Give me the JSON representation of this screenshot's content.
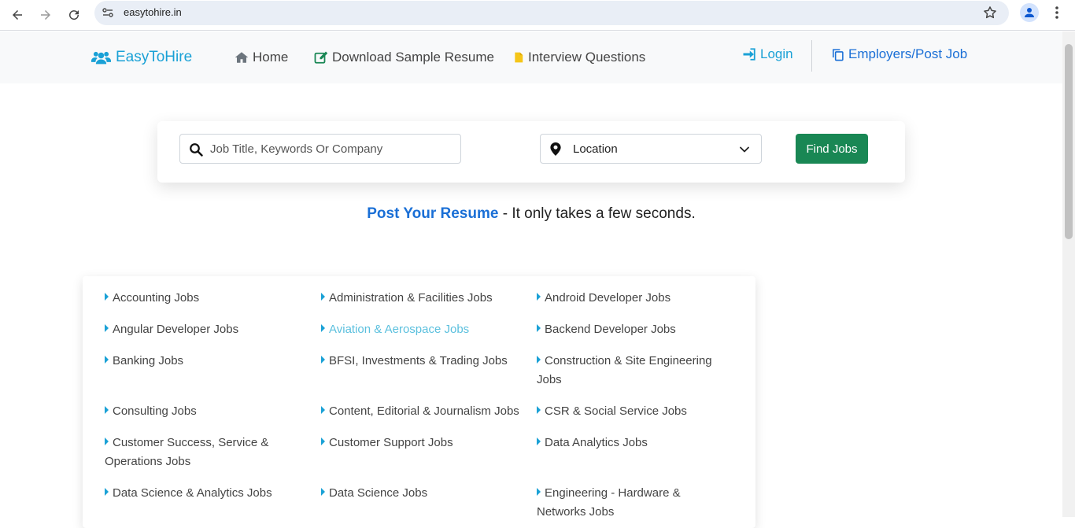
{
  "browser": {
    "url": "easytohire.in"
  },
  "header": {
    "brand": "EasyToHire",
    "nav": [
      {
        "label": "Home",
        "icon": "home-icon"
      },
      {
        "label": "Download Sample Resume",
        "icon": "edit-icon"
      },
      {
        "label": "Interview Questions",
        "icon": "file-icon"
      }
    ],
    "login": "Login",
    "employers": "Employers/Post Job",
    "colors": {
      "brand": "#1aa1d6",
      "employers": "#1a6fd6"
    }
  },
  "search": {
    "keyword_placeholder": "Job Title, Keywords Or Company",
    "location_value": "Location",
    "find_label": "Find Jobs",
    "button_color": "#198754"
  },
  "tagline": {
    "link": "Post Your Resume",
    "rest": "- It only takes a few seconds."
  },
  "categories": [
    [
      "Accounting Jobs",
      "Administration & Facilities Jobs",
      "Android Developer Jobs"
    ],
    [
      "Angular Developer Jobs",
      "Aviation & Aerospace Jobs",
      "Backend Developer Jobs"
    ],
    [
      "Banking Jobs",
      "BFSI, Investments & Trading Jobs",
      "Construction & Site Engineering Jobs"
    ],
    [
      "Consulting Jobs",
      "Content, Editorial & Journalism Jobs",
      "CSR & Social Service Jobs"
    ],
    [
      "Customer Success, Service & Operations Jobs",
      "Customer Support Jobs",
      "Data Analytics Jobs"
    ],
    [
      "Data Science & Analytics Jobs",
      "Data Science Jobs",
      "Engineering - Hardware & Networks Jobs"
    ]
  ]
}
